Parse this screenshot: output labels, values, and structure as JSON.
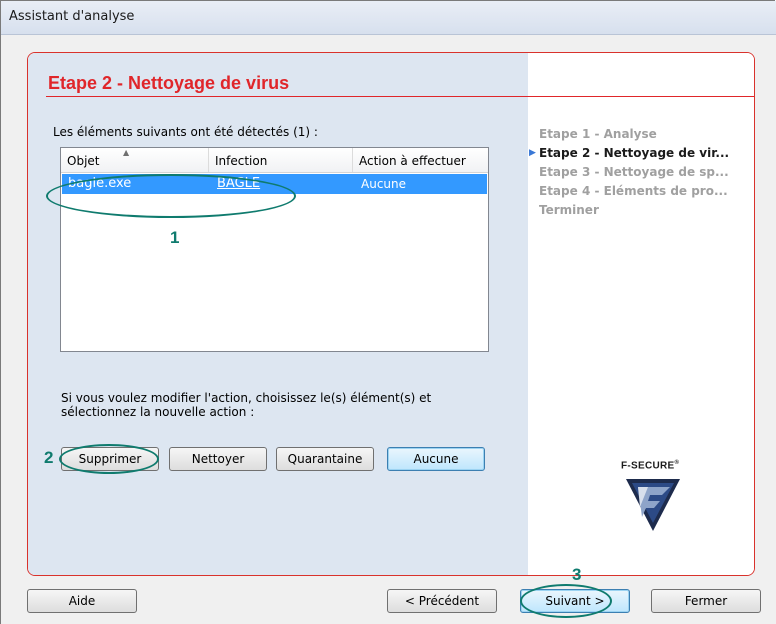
{
  "window": {
    "title": "Assistant d'analyse"
  },
  "header": {
    "step_title": "Etape 2 - Nettoyage de virus"
  },
  "detected": {
    "label": "Les éléments suivants ont été détectés (1) :",
    "columns": [
      "Objet",
      "Infection",
      "Action à effectuer"
    ],
    "rows": [
      {
        "object": "bagle.exe",
        "infection": "BAGLE",
        "action": "Aucune"
      }
    ]
  },
  "instructions": "Si vous voulez modifier l'action, choisissez le(s) élément(s) et sélectionnez la nouvelle action :",
  "actions": {
    "delete": "Supprimer",
    "clean": "Nettoyer",
    "quarantine": "Quarantaine",
    "none": "Aucune"
  },
  "steps": [
    {
      "label": "Etape 1 - Analyse",
      "current": false
    },
    {
      "label": "Etape 2 - Nettoyage de vir...",
      "current": true
    },
    {
      "label": "Etape 3 - Nettoyage de sp...",
      "current": false
    },
    {
      "label": "Etape 4 - Eléments de pro...",
      "current": false
    },
    {
      "label": "Terminer",
      "current": false
    }
  ],
  "logo": {
    "text": "F-SECURE",
    "mark": "®"
  },
  "footer": {
    "help": "Aide",
    "previous": "< Précédent",
    "next": "Suivant >",
    "close": "Fermer"
  },
  "callouts": [
    "1",
    "2",
    "3"
  ],
  "colors": {
    "accent_red": "#e0262a",
    "callout_teal": "#0f7b6e",
    "selection_blue": "#3399ff"
  }
}
